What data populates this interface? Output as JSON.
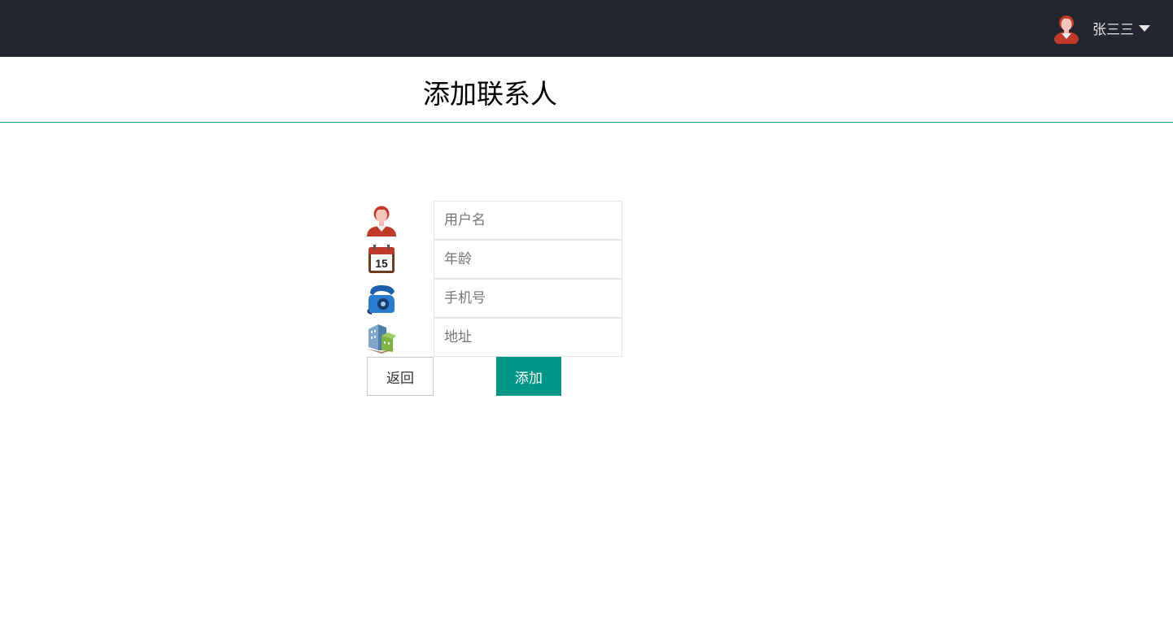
{
  "header": {
    "username": "张三三",
    "avatar_icon": "user-avatar-icon",
    "dropdown_icon": "caret-down-icon",
    "background": "#23262e"
  },
  "page": {
    "title": "添加联系人",
    "accent": "#009688"
  },
  "form": {
    "fields": [
      {
        "icon": "person-icon",
        "placeholder": "用户名",
        "value": ""
      },
      {
        "icon": "calendar-icon",
        "placeholder": "年龄",
        "value": "",
        "calendar_number": "15"
      },
      {
        "icon": "telephone-icon",
        "placeholder": "手机号",
        "value": ""
      },
      {
        "icon": "building-icon",
        "placeholder": "地址",
        "value": ""
      }
    ],
    "back_label": "返回",
    "add_label": "添加"
  }
}
